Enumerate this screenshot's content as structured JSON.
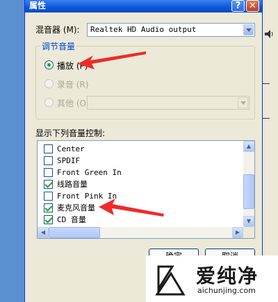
{
  "window": {
    "title": "属性",
    "help_label": "?",
    "close_label": "✕"
  },
  "mixer": {
    "label": "混音器 (M):",
    "value": "Realtek HD Audio output"
  },
  "volume_group": {
    "title": "调节音量",
    "options": [
      {
        "label": "播放 (P)",
        "selected": true,
        "enabled": true
      },
      {
        "label": "录音 (R)",
        "selected": false,
        "enabled": false
      },
      {
        "label": "其他 (O)",
        "selected": false,
        "enabled": false
      }
    ],
    "other_combo_value": ""
  },
  "controls": {
    "label": "显示下列音量控制:",
    "items": [
      {
        "label": "Center",
        "checked": false
      },
      {
        "label": "SPDIF",
        "checked": false
      },
      {
        "label": "Front Green In",
        "checked": false
      },
      {
        "label": "线路音量",
        "checked": true
      },
      {
        "label": "Front Pink In",
        "checked": false
      },
      {
        "label": "麦克风音量",
        "checked": true
      },
      {
        "label": "CD 音量",
        "checked": true
      }
    ]
  },
  "buttons": {
    "ok": "确定",
    "cancel": "取消"
  },
  "watermark": {
    "cn": "爱纯净",
    "en": "aichunjing.com"
  },
  "colors": {
    "titlebar": "#0a58d8",
    "arrow": "#ee2b2b",
    "check": "#21a121",
    "group_title": "#0046d5"
  }
}
